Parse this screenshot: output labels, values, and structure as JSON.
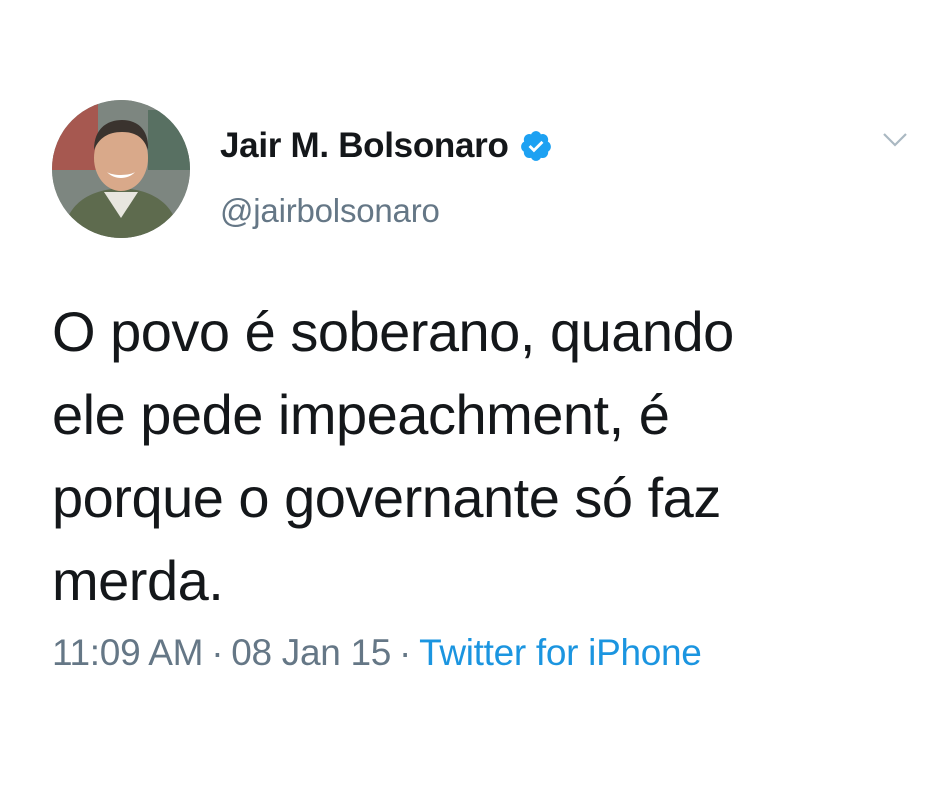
{
  "tweet": {
    "author": {
      "display_name": "Jair M. Bolsonaro",
      "handle": "@jairbolsonaro",
      "verified": true
    },
    "lines": [
      "O povo é soberano, quando",
      "ele pede impeachment, é",
      "porque o governante só faz",
      "merda."
    ],
    "time": "11:09 AM",
    "date": "08 Jan 15",
    "separator": "·",
    "source": "Twitter for iPhone"
  },
  "colors": {
    "text": "#14171a",
    "secondary": "#657786",
    "link": "#1b95e0",
    "verified_badge": "#1da1f2"
  },
  "icons": {
    "verified": "verified-badge-icon",
    "more": "chevron-down-icon",
    "avatar": "profile-photo"
  }
}
